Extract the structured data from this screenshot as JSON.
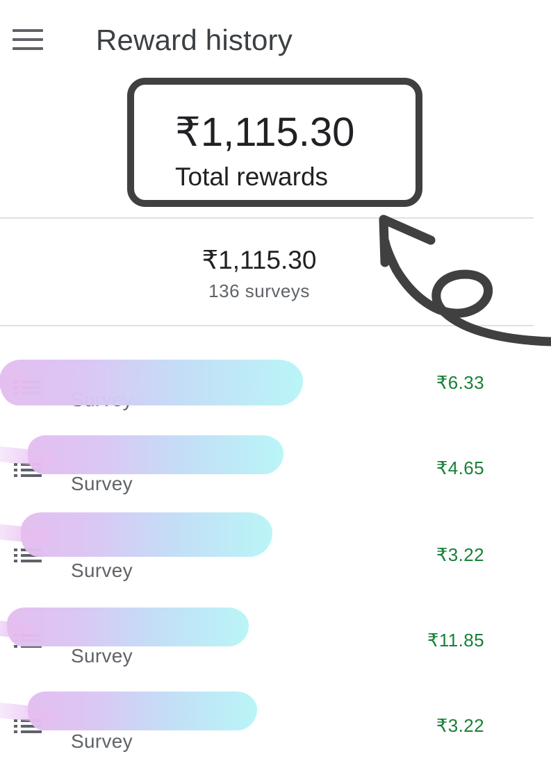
{
  "header": {
    "menu_icon": "hamburger-menu-icon",
    "title": "Reward history"
  },
  "highlight": {
    "amount": "₹1,115.30",
    "label": "Total rewards"
  },
  "summary": {
    "amount": "₹1,115.30",
    "count": "136 surveys"
  },
  "colors": {
    "amount_green": "#188038",
    "annotation_gray": "#404040"
  },
  "rewards": [
    {
      "type": "Survey",
      "amount": "₹6.33",
      "icon": "list-icon"
    },
    {
      "type": "Survey",
      "amount": "₹4.65",
      "icon": "list-icon"
    },
    {
      "type": "Survey",
      "amount": "₹3.22",
      "icon": "list-icon"
    },
    {
      "type": "Survey",
      "amount": "₹11.85",
      "icon": "list-icon"
    },
    {
      "type": "Survey",
      "amount": "₹3.22",
      "icon": "list-icon"
    }
  ]
}
